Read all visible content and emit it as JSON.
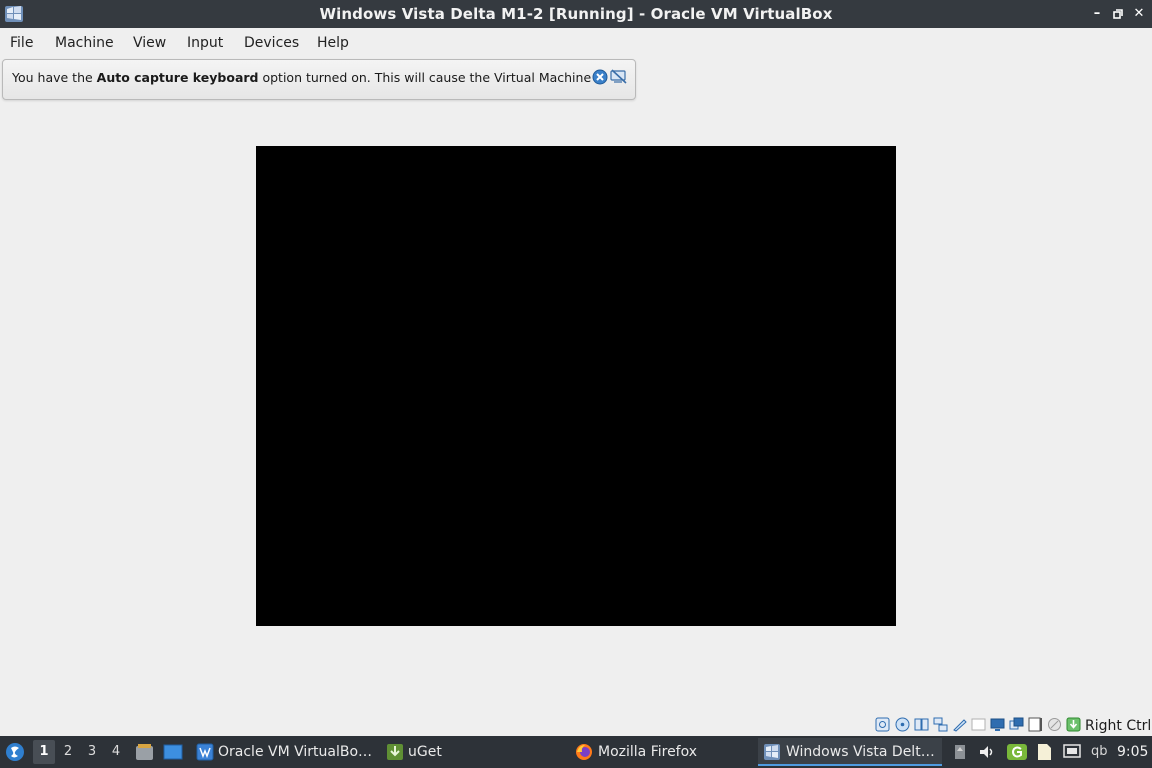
{
  "window": {
    "title": "Windows Vista Delta M1-2 [Running] - Oracle VM VirtualBox"
  },
  "menu": {
    "items": [
      "File",
      "Machine",
      "View",
      "Input",
      "Devices",
      "Help"
    ]
  },
  "notice": {
    "text_before": "You have the ",
    "text_bold": "Auto capture keyboard",
    "text_after": " option turned on. This will cause the Virtual Machine to"
  },
  "statusbar": {
    "host_key": "Right Ctrl",
    "icons": [
      "hard-disk-icon",
      "optical-drive-icon",
      "audio-icon",
      "network-icon",
      "usb-icon",
      "shared-folders-icon",
      "display-icon",
      "recording-icon",
      "vt-x-icon",
      "mouse-integration-icon",
      "keyboard-capture-icon"
    ]
  },
  "taskbar": {
    "desktops": [
      "1",
      "2",
      "3",
      "4"
    ],
    "active_desktop": "1",
    "tasks": [
      {
        "label": "Oracle VM VirtualBo…",
        "icon": "virtualbox-icon"
      },
      {
        "label": "uGet",
        "icon": "uget-icon"
      },
      {
        "label": "Mozilla Firefox",
        "icon": "firefox-icon"
      },
      {
        "label": "Windows Vista Delt…",
        "icon": "vista-vm-icon",
        "active": true
      }
    ],
    "tray_text": "qb",
    "clock": "9:05"
  },
  "colors": {
    "titlebar": "#353a40",
    "taskbar": "#2d3238",
    "window_bg": "#efefef",
    "vm_screen": "#000000",
    "accent": "#4f9be0"
  }
}
